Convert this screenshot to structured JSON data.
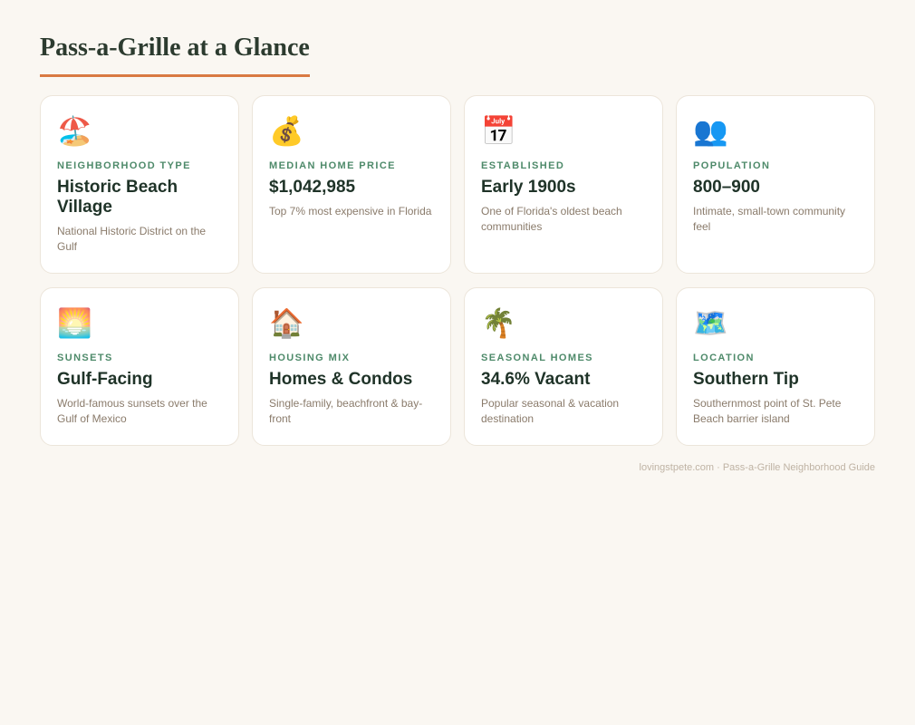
{
  "page": {
    "title": "Pass-a-Grille at a Glance",
    "footer": "lovingstpete.com · Pass-a-Grille Neighborhood Guide"
  },
  "colors": {
    "accent": "#d97a43",
    "label_green": "#4e8a6a",
    "heading": "#2c3b2f",
    "background": "#faf7f2"
  },
  "cards": [
    {
      "icon_name": "beach-umbrella-icon",
      "icon": "🏖️",
      "label": "NEIGHBORHOOD TYPE",
      "value": "Historic Beach Village",
      "desc": "National Historic District on the Gulf"
    },
    {
      "icon_name": "money-bag-icon",
      "icon": "💰",
      "label": "MEDIAN HOME PRICE",
      "value": "$1,042,985",
      "desc": "Top 7% most expensive in Florida"
    },
    {
      "icon_name": "calendar-icon",
      "icon": "📅",
      "label": "ESTABLISHED",
      "value": "Early 1900s",
      "desc": "One of Florida's oldest beach communities"
    },
    {
      "icon_name": "people-icon",
      "icon": "👥",
      "label": "POPULATION",
      "value": "800–900",
      "desc": "Intimate, small-town community feel"
    },
    {
      "icon_name": "sunrise-icon",
      "icon": "🌅",
      "label": "SUNSETS",
      "value": "Gulf-Facing",
      "desc": "World-famous sunsets over the Gulf of Mexico"
    },
    {
      "icon_name": "house-icon",
      "icon": "🏠",
      "label": "HOUSING MIX",
      "value": "Homes & Condos",
      "desc": "Single-family, beachfront & bay-front"
    },
    {
      "icon_name": "palm-tree-icon",
      "icon": "🌴",
      "label": "SEASONAL HOMES",
      "value": "34.6% Vacant",
      "desc": "Popular seasonal & vacation destination"
    },
    {
      "icon_name": "map-icon",
      "icon": "🗺️",
      "label": "LOCATION",
      "value": "Southern Tip",
      "desc": "Southernmost point of St. Pete Beach barrier island"
    }
  ]
}
